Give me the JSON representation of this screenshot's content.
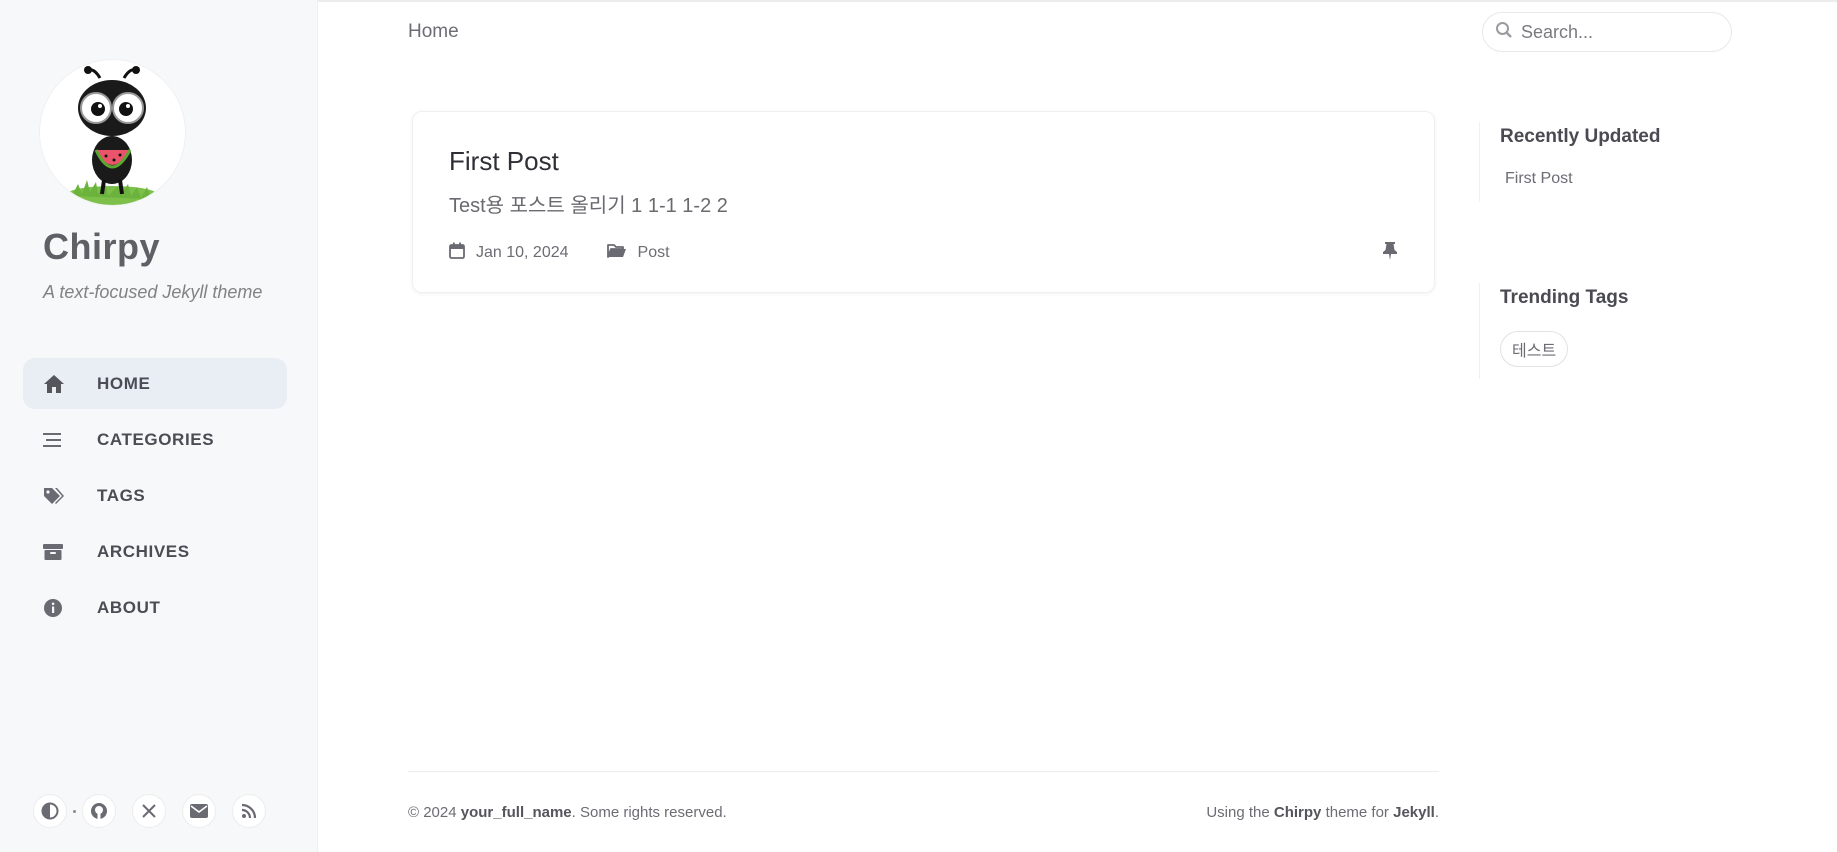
{
  "sidebar": {
    "site_title": "Chirpy",
    "site_subtitle": "A text-focused Jekyll theme",
    "nav": [
      {
        "label": "HOME",
        "icon": "home-icon",
        "active": true
      },
      {
        "label": "CATEGORIES",
        "icon": "stream-icon",
        "active": false
      },
      {
        "label": "TAGS",
        "icon": "tags-icon",
        "active": false
      },
      {
        "label": "ARCHIVES",
        "icon": "archive-icon",
        "active": false
      },
      {
        "label": "ABOUT",
        "icon": "info-circle-icon",
        "active": false
      }
    ],
    "bottom_icons": [
      "theme-toggle-icon",
      "github-icon",
      "x-twitter-icon",
      "email-icon",
      "rss-icon"
    ]
  },
  "topbar": {
    "breadcrumb": "Home",
    "search_placeholder": "Search..."
  },
  "post": {
    "title": "First Post",
    "excerpt": "Test용 포스트 올리기 1 1-1 1-2 2",
    "date": "Jan 10, 2024",
    "category": "Post",
    "pinned": true
  },
  "panels": {
    "recent_title": "Recently Updated",
    "recent_items": [
      "First Post"
    ],
    "trending_title": "Trending Tags",
    "tags": [
      "테스트"
    ]
  },
  "footer": {
    "year": "© 2024",
    "author": "your_full_name",
    "rights": ". Some rights reserved.",
    "using": "Using the",
    "theme": "Chirpy",
    "theme_for": "theme for",
    "engine": "Jekyll",
    "period": "."
  },
  "colors": {
    "sidebar_bg": "#f6f8fa",
    "active_nav_bg": "#e9edf4",
    "text": "#34343c",
    "muted": "#6c6c74"
  }
}
